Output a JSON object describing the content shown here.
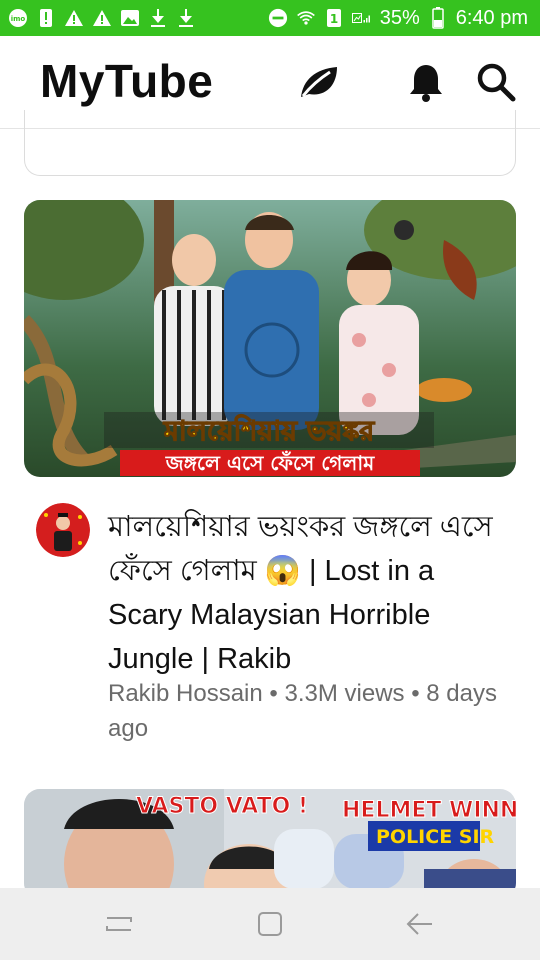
{
  "status_bar": {
    "battery": "35%",
    "time": "6:40 pm",
    "left_icons": [
      "imo-icon",
      "alert-icon",
      "warning-icon",
      "warning-icon",
      "image-icon",
      "download-icon",
      "download-icon"
    ],
    "right_icons": [
      "dnd-icon",
      "wifi-icon",
      "sim1-icon",
      "signal-icon",
      "battery-icon"
    ]
  },
  "app_bar": {
    "title": "MyTube",
    "icons": [
      "leaf-icon",
      "bell-icon",
      "search-icon"
    ]
  },
  "feed": {
    "videos": [
      {
        "title": "মালয়েশিয়ার ভয়ংকর জঙ্গলে এসে ফেঁসে গেলাম 😱 | Lost in a Scary Malaysian Horrible Jungle | Rakib",
        "channel": "Rakib Hossain",
        "views": "3.3M views",
        "age": "8 days ago",
        "thumbnail_caption_line1": "মালয়েশিয়ায় ভয়ঙ্কর",
        "thumbnail_caption_line2": "জঙ্গলে এসে ফেঁসে গেলাম"
      },
      {
        "thumbnail_text_left": "VASTO VATO !",
        "thumbnail_text_right_line1": "HELMET WINNER",
        "thumbnail_text_right_line2": "POLICE SIR"
      }
    ]
  },
  "nav_bar": {
    "buttons": [
      "recents-button",
      "home-button",
      "back-button"
    ]
  },
  "colors": {
    "status_bar": "#36c21f",
    "nav_bar": "#eeeeee",
    "caption_yellow": "#ffd400",
    "caption_red": "#d81b1b"
  }
}
